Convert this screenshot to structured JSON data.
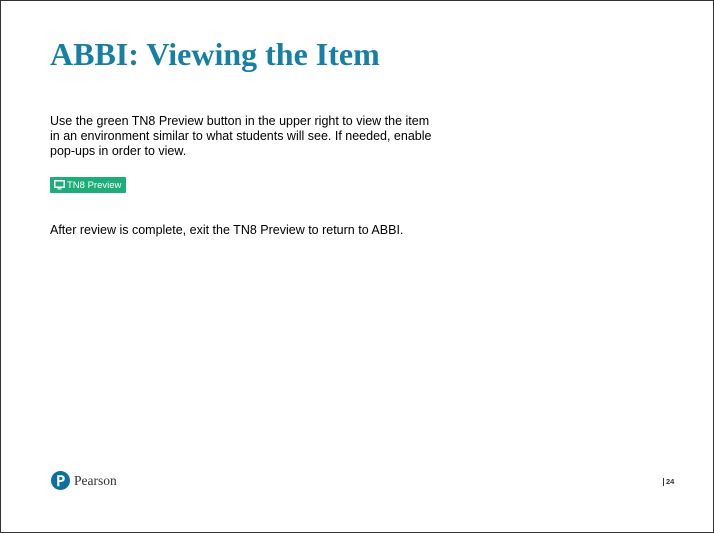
{
  "slide": {
    "title": "ABBI: Viewing the Item",
    "body_lines": [
      "Use the green TN8 Preview button in the upper right to view the item",
      "in an environment  similar to what students will see. If needed, enable",
      "pop-ups in order to view."
    ],
    "preview_button": {
      "label": "TN8 Preview",
      "icon": "monitor-icon",
      "color": "#1cad7a"
    },
    "after_text": "After review is complete, exit the TN8 Preview to return to ABBI.",
    "logo_text": "Pearson",
    "page_number": "24",
    "title_color": "#157fa4"
  }
}
